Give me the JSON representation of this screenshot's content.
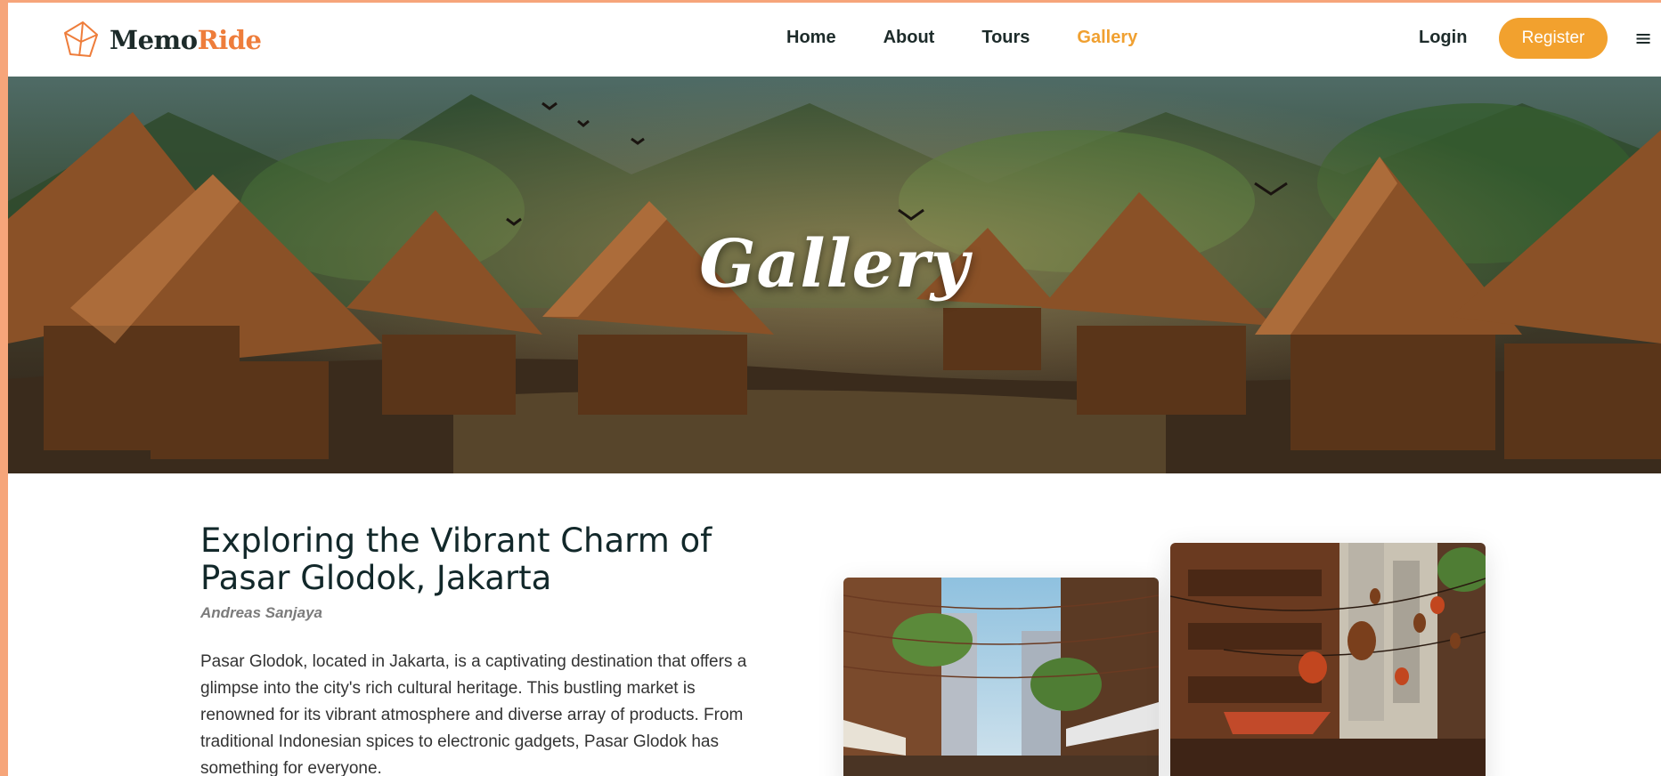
{
  "brand": {
    "part1": "Memo",
    "part2": "Ride",
    "accent_color": "#ee7d3b"
  },
  "nav": {
    "items": [
      {
        "label": "Home",
        "active": false
      },
      {
        "label": "About",
        "active": false
      },
      {
        "label": "Tours",
        "active": false
      },
      {
        "label": "Gallery",
        "active": true
      }
    ],
    "active_color": "#f0a030"
  },
  "auth": {
    "login_label": "Login",
    "register_label": "Register",
    "register_color": "#f2a12e"
  },
  "menu": {
    "icon": "hamburger-menu-icon",
    "glyph": "≡"
  },
  "hero": {
    "title": "Gallery"
  },
  "article": {
    "title": "Exploring the Vibrant Charm of Pasar Glodok, Jakarta",
    "author": "Andreas Sanjaya",
    "body": "Pasar Glodok, located in Jakarta, is a captivating destination that offers a glimpse into the city's rich cultural heritage. This bustling market is renowned for its vibrant atmosphere and diverse array of products. From traditional Indonesian spices to electronic gadgets, Pasar Glodok has something for everyone."
  }
}
